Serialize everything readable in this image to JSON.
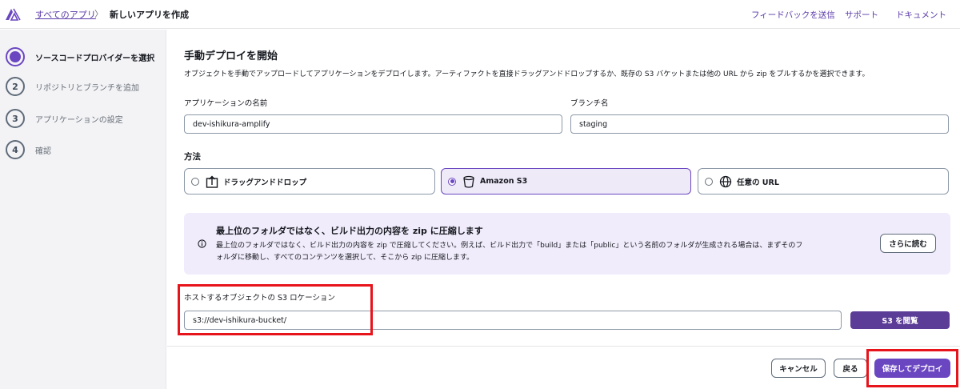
{
  "breadcrumb": {
    "parent": "すべてのアプリ",
    "separator": "〉",
    "current": "新しいアプリを作成"
  },
  "toplinks": {
    "feedback": "フィードバックを送信",
    "support": "サポート",
    "docs": "ドキュメント"
  },
  "steps": [
    {
      "number": "1",
      "label": "ソースコードプロバイダーを選択",
      "active": true
    },
    {
      "number": "2",
      "label": "リポジトリとブランチを追加",
      "active": false
    },
    {
      "number": "3",
      "label": "アプリケーションの設定",
      "active": false
    },
    {
      "number": "4",
      "label": "確認",
      "active": false
    }
  ],
  "main": {
    "title": "手動デプロイを開始",
    "description": "オブジェクトを手動でアップロードしてアプリケーションをデプロイします。アーティファクトを直接ドラッグアンドドロップするか、既存の S3 バケットまたは他の URL から zip をプルするかを選択できます。",
    "app_name_label": "アプリケーションの名前",
    "app_name_value": "dev-ishikura-amplify",
    "branch_label": "ブランチ名",
    "branch_value": "staging",
    "method_label": "方法",
    "methods": [
      {
        "label": "ドラッグアンドドロップ",
        "icon": "upload-icon",
        "selected": false
      },
      {
        "label": "Amazon S3",
        "icon": "bucket-icon",
        "selected": true
      },
      {
        "label": "任意の URL",
        "icon": "globe-icon",
        "selected": false
      }
    ],
    "info": {
      "title": "最上位のフォルダではなく、ビルド出力の内容を zip に圧縮します",
      "body": "最上位のフォルダではなく、ビルド出力の内容を zip で圧縮してください。例えば、ビルド出力で「build」または「public」という名前のフォルダが生成される場合は、まずそのフォルダに移動し、すべてのコンテンツを選択して、そこから zip に圧縮します。",
      "more_button": "さらに読む"
    },
    "s3_label": "ホストするオブジェクトの S3 ロケーション",
    "s3_value": "s3://dev-ishikura-bucket/",
    "browse_button": "S3 を閲覧"
  },
  "footer": {
    "cancel": "キャンセル",
    "back": "戻る",
    "save_deploy": "保存してデプロイ"
  },
  "colors": {
    "accent": "#6b46c1",
    "annotation": "#e8141c"
  }
}
